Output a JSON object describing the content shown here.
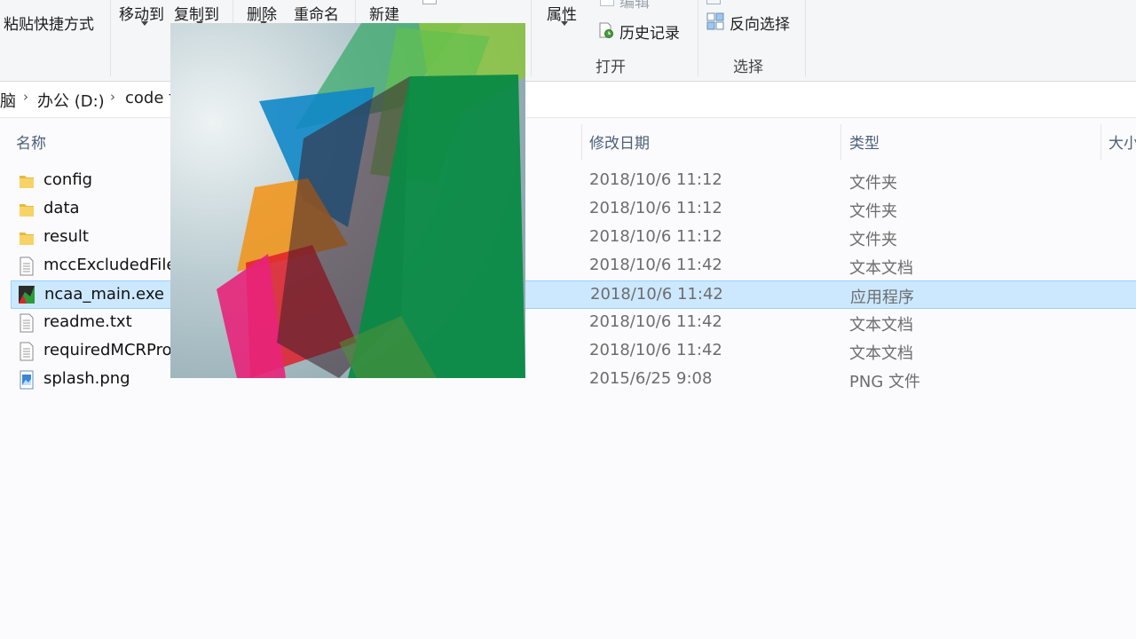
{
  "ribbon": {
    "paste_shortcut": "粘贴快捷方式",
    "move_to": "移动到",
    "copy_to": "复制到",
    "delete": "删除",
    "rename": "重命名",
    "new_folder": "新建",
    "properties": "属性",
    "edit": "编辑",
    "history": "历史记录",
    "open_group": "打开",
    "invert_selection": "反向选择",
    "select_group": "选择"
  },
  "address": {
    "crumbs": [
      "脑",
      "办公 (D:)",
      "code f"
    ]
  },
  "columns": {
    "name": "名称",
    "date": "修改日期",
    "type": "类型",
    "size": "大小"
  },
  "files": [
    {
      "name": "config",
      "date": "2018/10/6 11:12",
      "type": "文件夹",
      "icon": "folder-icon"
    },
    {
      "name": "data",
      "date": "2018/10/6 11:12",
      "type": "文件夹",
      "icon": "folder-icon"
    },
    {
      "name": "result",
      "date": "2018/10/6 11:12",
      "type": "文件夹",
      "icon": "folder-icon"
    },
    {
      "name": "mccExcludedFile",
      "date": "2018/10/6 11:42",
      "type": "文本文档",
      "icon": "text-file-icon"
    },
    {
      "name": "ncaa_main.exe",
      "date": "2018/10/6 11:42",
      "type": "应用程序",
      "icon": "matlab-app-icon",
      "selected": true
    },
    {
      "name": "readme.txt",
      "date": "2018/10/6 11:42",
      "type": "文本文档",
      "icon": "text-file-icon"
    },
    {
      "name": "requiredMCRPro",
      "date": "2018/10/6 11:42",
      "type": "文本文档",
      "icon": "text-file-icon"
    },
    {
      "name": "splash.png",
      "date": "2015/6/25 9:08",
      "type": "PNG 文件",
      "icon": "image-file-icon"
    }
  ],
  "colors": {
    "selection_bg": "#cce8ff",
    "selection_border": "#99d1ff",
    "header_text": "#4c607a"
  }
}
